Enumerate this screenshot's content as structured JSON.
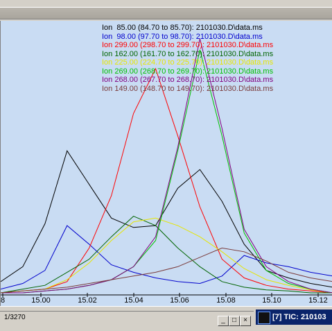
{
  "legend": [
    {
      "text": "Ion  85.00 (84.70 to 85.70): 2101030.D\\data.ms",
      "color": "#000000"
    },
    {
      "text": "Ion  98.00 (97.70 to 98.70): 2101030.D\\data.ms",
      "color": "#0000cc"
    },
    {
      "text": "Ion 299.00 (298.70 to 299.70): 2101030.D\\data.ms",
      "color": "#ff0000"
    },
    {
      "text": "Ion 162.00 (161.70 to 162.70): 2101030.D\\data.ms",
      "color": "#006400"
    },
    {
      "text": "Ion 225.00 (224.70 to 225.70): 2101030.D\\data.ms",
      "color": "#e6e600"
    },
    {
      "text": "Ion 269.00 (268.70 to 269.70): 2101030.D\\data.ms",
      "color": "#00c000"
    },
    {
      "text": "Ion 268.00 (267.70 to 268.70): 2101030.D\\data.ms",
      "color": "#800080"
    },
    {
      "text": "Ion 149.00 (148.70 to 149.70): 2101030.D\\data.ms",
      "color": "#7a3a3a"
    }
  ],
  "x_ticks": [
    "8",
    "15.00",
    "15.02",
    "15.04",
    "15.06",
    "15.08",
    "15.10",
    "15.12"
  ],
  "bottom": {
    "left_title": "1/3270",
    "right_title": "[7] TIC: 210103"
  },
  "chart_data": {
    "type": "line",
    "xlabel": "",
    "ylabel": "",
    "x": [
      14.98,
      14.99,
      15.0,
      15.01,
      15.02,
      15.03,
      15.04,
      15.05,
      15.06,
      15.07,
      15.08,
      15.09,
      15.1,
      15.11,
      15.12,
      15.13
    ],
    "series": [
      {
        "values": [
          30,
          70,
          185,
          380,
          290,
          200,
          175,
          180,
          280,
          330,
          245,
          130,
          60,
          40,
          25,
          15
        ]
      },
      {
        "values": [
          10,
          25,
          60,
          180,
          130,
          75,
          55,
          40,
          30,
          25,
          45,
          100,
          80,
          70,
          55,
          45
        ]
      },
      {
        "values": [
          0,
          5,
          10,
          30,
          120,
          260,
          480,
          600,
          420,
          230,
          90,
          40,
          20,
          10,
          5,
          0
        ]
      },
      {
        "values": [
          0,
          10,
          20,
          55,
          90,
          150,
          205,
          180,
          120,
          70,
          30,
          15,
          8,
          5,
          0,
          0
        ]
      },
      {
        "values": [
          0,
          5,
          10,
          35,
          80,
          140,
          190,
          200,
          180,
          150,
          110,
          65,
          35,
          20,
          8,
          0
        ]
      },
      {
        "values": [
          0,
          0,
          5,
          10,
          20,
          35,
          70,
          140,
          380,
          650,
          420,
          160,
          60,
          25,
          10,
          0
        ]
      },
      {
        "values": [
          0,
          0,
          5,
          10,
          20,
          35,
          70,
          150,
          390,
          680,
          440,
          170,
          70,
          30,
          10,
          0
        ]
      },
      {
        "values": [
          0,
          5,
          10,
          15,
          25,
          35,
          45,
          55,
          70,
          95,
          120,
          110,
          85,
          55,
          40,
          30
        ]
      }
    ]
  }
}
